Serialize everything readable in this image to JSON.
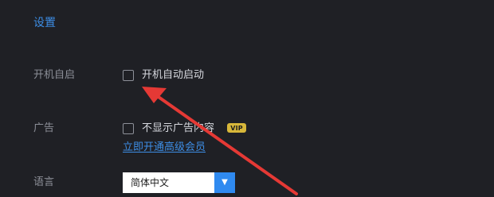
{
  "settings": {
    "title": "设置",
    "rows": {
      "startup": {
        "label": "开机自启",
        "option": "开机自动启动",
        "checked": false
      },
      "ads": {
        "label": "广告",
        "option": "不显示广告内容",
        "checked": false,
        "badge": "VIP",
        "link": "立即开通高级会员"
      },
      "language": {
        "label": "语言",
        "selected": "简体中文"
      }
    }
  },
  "icons": {
    "dropdown": "chevron-down-icon"
  },
  "colors": {
    "accent": "#3d8ee6",
    "background": "#1f2025",
    "arrow": "#e53935",
    "badge": "#d7b73a"
  }
}
